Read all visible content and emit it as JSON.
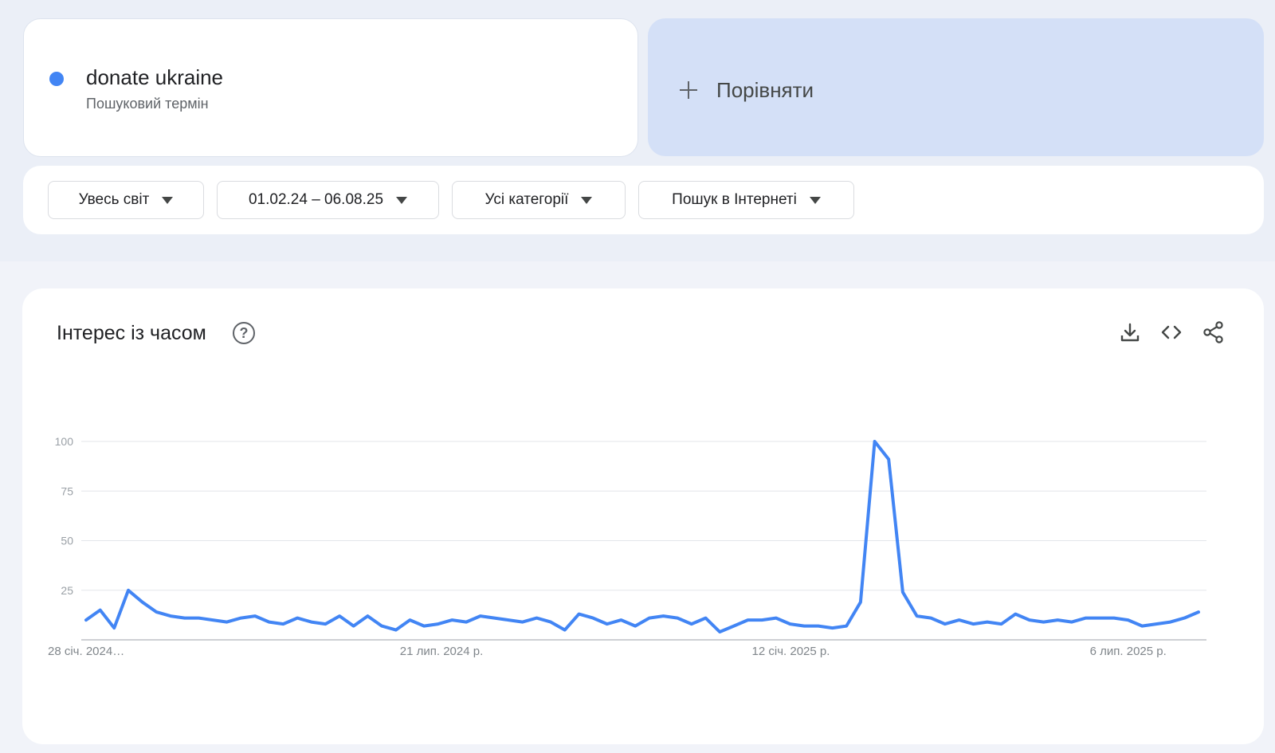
{
  "term": {
    "name": "donate ukraine",
    "type": "Пошуковий термін",
    "color": "#4285f4"
  },
  "compare": {
    "label": "Порівняти",
    "icon": "plus-icon"
  },
  "filters": [
    {
      "label": "Увесь світ"
    },
    {
      "label": "01.02.24 – 06.08.25"
    },
    {
      "label": "Усі категорії"
    },
    {
      "label": "Пошук в Інтернеті"
    }
  ],
  "panel": {
    "title": "Інтерес із часом",
    "icons": [
      "help-icon",
      "download-icon",
      "embed-code-icon",
      "share-icon"
    ]
  },
  "chart_data": {
    "type": "line",
    "series": [
      {
        "name": "donate ukraine",
        "color": "#4285f4",
        "values": [
          10,
          15,
          6,
          25,
          19,
          14,
          12,
          11,
          11,
          10,
          9,
          11,
          12,
          9,
          8,
          11,
          9,
          8,
          12,
          7,
          12,
          7,
          5,
          10,
          7,
          8,
          10,
          9,
          12,
          11,
          10,
          9,
          11,
          9,
          5,
          13,
          11,
          8,
          10,
          7,
          11,
          12,
          11,
          8,
          11,
          4,
          7,
          10,
          10,
          11,
          8,
          7,
          7,
          6,
          7,
          19,
          100,
          91,
          24,
          12,
          11,
          8,
          10,
          8,
          9,
          8,
          13,
          10,
          9,
          10,
          9,
          11,
          11,
          11,
          10,
          7,
          8,
          9,
          11,
          14
        ]
      }
    ],
    "x_tick_labels": [
      "28 січ. 2024…",
      "21 лип. 2024 р.",
      "12 січ. 2025 р.",
      "6 лип. 2025 р."
    ],
    "y_ticks": [
      100,
      75,
      50,
      25
    ],
    "ylim": [
      0,
      100
    ],
    "grid": true
  }
}
